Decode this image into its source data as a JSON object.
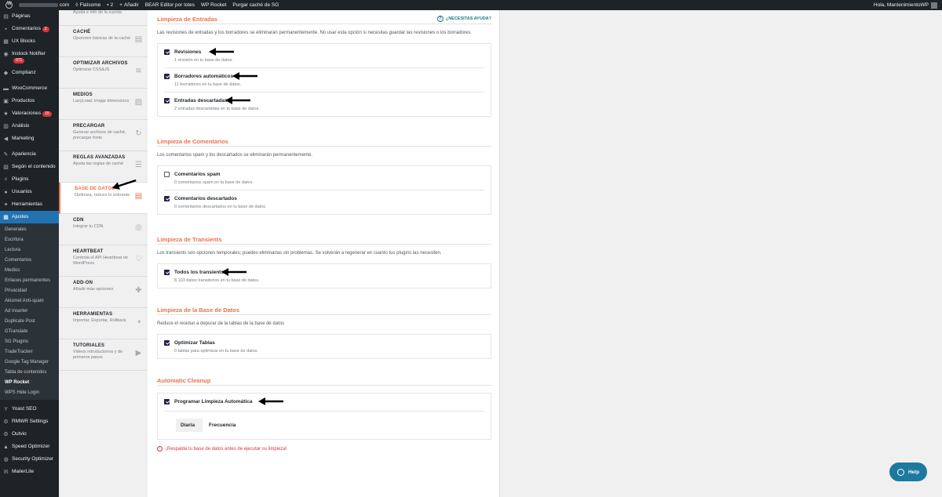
{
  "adminbar": {
    "site_suffix": "com",
    "flatsome": "Flatsome",
    "comments_count": "2",
    "add_new": "Añadir",
    "bear": "BEAR Editor por lotes",
    "wprocket": "WP Rocket",
    "purge": "Purgar caché de SG",
    "greeting": "Hola, MantenimientoWP"
  },
  "adminmenu": {
    "items_top": [
      {
        "label": "Páginas",
        "icon": "page-icon"
      },
      {
        "label": "Comentarios",
        "icon": "comment-icon",
        "badge": "2"
      },
      {
        "label": "UX Blocks",
        "icon": "blocks-icon"
      },
      {
        "label": "Instock Notifier",
        "icon": "bell-icon",
        "badge": "971"
      },
      {
        "label": "Complianz",
        "icon": "shield-icon"
      }
    ],
    "items_mid": [
      {
        "label": "WooCommerce",
        "icon": "woo-icon"
      },
      {
        "label": "Productos",
        "icon": "box-icon"
      },
      {
        "label": "Valoraciones",
        "icon": "star-icon",
        "badge": "15"
      },
      {
        "label": "Análisis",
        "icon": "chart-icon"
      },
      {
        "label": "Marketing",
        "icon": "megaphone-icon"
      }
    ],
    "items_low": [
      {
        "label": "Apariencia",
        "icon": "brush-icon"
      },
      {
        "label": "Según el contenido",
        "icon": "content-icon"
      },
      {
        "label": "Plugins",
        "icon": "plug-icon"
      },
      {
        "label": "Usuarios",
        "icon": "user-icon"
      },
      {
        "label": "Herramientas",
        "icon": "wrench-icon"
      }
    ],
    "active": {
      "label": "Ajustes",
      "icon": "settings-icon"
    },
    "submenu": [
      "Generales",
      "Escritura",
      "Lectura",
      "Comentarios",
      "Medios",
      "Enlaces permanentes",
      "Privacidad",
      "Akismet Anti-spam",
      "Ad Inserter",
      "Duplicate Post",
      "GTranslate",
      "SG Plugins",
      "TradeTracker",
      "Google Tag Manager",
      "Tabla de contenidos",
      "WP Rocket",
      "WPS Hide Login"
    ],
    "submenu_current": "WP Rocket",
    "items_bottom": [
      {
        "label": "Yoast SEO",
        "icon": "yoast-icon"
      },
      {
        "label": "RMWR Settings",
        "icon": "gear-icon"
      },
      {
        "label": "Outvio",
        "icon": "gear-icon"
      },
      {
        "label": "Speed Optimizer",
        "icon": "speed-icon"
      },
      {
        "label": "Security Optimizer",
        "icon": "lock-icon"
      },
      {
        "label": "MailerLite",
        "icon": "mail-icon"
      }
    ]
  },
  "rocketnav": {
    "first_desc": "Ayuda e info de la cuenta",
    "items": [
      {
        "title": "CACHÉ",
        "desc": "Opciones básicas de la caché",
        "icon": "page-icon"
      },
      {
        "title": "OPTIMIZAR ARCHIVOS",
        "desc": "Optimizar CSS&JS",
        "icon": "layers-icon"
      },
      {
        "title": "MEDIOS",
        "desc": "LazyLoad, image dimensions",
        "icon": "image-icon"
      },
      {
        "title": "PRECARGAR",
        "desc": "Generar archivos de caché, precargar fonts",
        "icon": "refresh-icon"
      },
      {
        "title": "REGLAS AVANZADAS",
        "desc": "Ajusta las reglas de caché",
        "icon": "list-icon"
      },
      {
        "title": "BASE DE DATOS",
        "desc": "Optimiza, reduce lo sobrante",
        "icon": "database-icon",
        "active": true
      },
      {
        "title": "CDN",
        "desc": "Integrar tu CDN",
        "icon": "cdn-icon"
      },
      {
        "title": "HEARTBEAT",
        "desc": "Controla el API Heartbeat de WordPress",
        "icon": "heart-icon"
      },
      {
        "title": "ADD-ON",
        "desc": "Añadir más opciones",
        "icon": "addon-icon"
      },
      {
        "title": "HERRAMIENTAS",
        "desc": "Importar, Exportar, Rollback",
        "icon": "tools-icon"
      },
      {
        "title": "TUTORIALES",
        "desc": "Videos introductorios y de primeros pasos",
        "icon": "video-icon"
      }
    ]
  },
  "content": {
    "help_link": "¿NECESITAS AYUDA?",
    "sections": {
      "entradas": {
        "title": "Limpieza de Entradas",
        "desc": "Las revisiones de entradas y los borradores se eliminarán permanentemente. No usar esta opción si necesitas guardar las revisiones o los borradores.",
        "options": [
          {
            "label": "Revisiones",
            "desc": "1 revisión en tu base de datos.",
            "checked": true
          },
          {
            "label": "Borradores automáticos",
            "desc": "11 borradores en tu base de datos.",
            "checked": true
          },
          {
            "label": "Entradas descartadas",
            "desc": "2 entradas descartadas en tu base de datos.",
            "checked": true
          }
        ]
      },
      "comentarios": {
        "title": "Limpieza de Comentarios",
        "desc": "Los comentarios spam y los descartados se eliminarán permanentemente.",
        "options": [
          {
            "label": "Comentarios spam",
            "desc": "0 comentarios spam en tu base de datos.",
            "checked": false
          },
          {
            "label": "Comentarios descartados",
            "desc": "0 comentarios descartados en tu base de datos.",
            "checked": true
          }
        ]
      },
      "transients": {
        "title": "Limpieza de Transients",
        "desc": "Los transients son opciones temporales; puedes eliminarlas sin problemas. Se volverán a regenerar en cuanto tus plugins las necesiten.",
        "options": [
          {
            "label": "Todos los transients",
            "desc": "8.103 datos transitorios en tu base de datos.",
            "checked": true
          }
        ]
      },
      "basedatos": {
        "title": "Limpieza de la Base de Datos",
        "desc": "Reduce el residuo a depurar de la tablas de la base de datos",
        "options": [
          {
            "label": "Optimizar Tablas",
            "desc": "0 tablas para optimizar en tu base de datos.",
            "checked": true
          }
        ]
      },
      "auto": {
        "title": "Automatic Cleanup",
        "option": {
          "label": "Programar Limpieza Automática",
          "checked": true
        },
        "freq_value": "Diaria",
        "freq_label": "Frecuencia"
      }
    },
    "warning": "¡Respalda tu base de datos antes de ejecutar su limpieza!"
  },
  "help_button": "Help",
  "colors": {
    "accent": "#e8724b",
    "checkbox": "#2a1f4a",
    "help": "#1d7a9e",
    "sidebar": "#1d2327",
    "active": "#2271b1"
  }
}
